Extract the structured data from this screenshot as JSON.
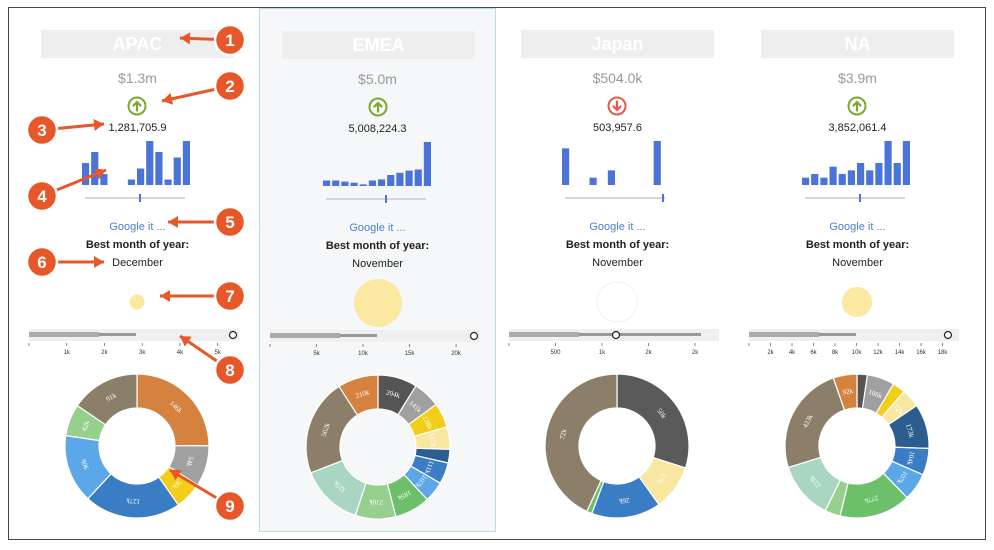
{
  "regions": [
    {
      "name": "APAC",
      "total": "$1.3m",
      "exact": "1,281,705.9",
      "trend": "up",
      "monthly": [
        4,
        6,
        2,
        0,
        0,
        1,
        3,
        8,
        6,
        1,
        5,
        8
      ],
      "slider_value": 0.55,
      "google_label": "Google it ...",
      "best_label": "Best month of year:",
      "best_value": "December",
      "bubble_scale": 0.18,
      "ticks": [
        "1k",
        "2k",
        "3k",
        "4k",
        "5k"
      ],
      "marker_value": 5.7,
      "donut": [
        {
          "label": "146k",
          "value": 146,
          "color": "#d4823e"
        },
        {
          "label": "54k",
          "value": 54,
          "color": "#a0a0a0"
        },
        {
          "label": "36k",
          "value": 36,
          "color": "#f2cd1a"
        },
        {
          "label": "127k",
          "value": 127,
          "color": "#3b7dc4"
        },
        {
          "label": "90k",
          "value": 90,
          "color": "#5ba7e8"
        },
        {
          "label": "42k",
          "value": 42,
          "color": "#96cf8e"
        },
        {
          "label": "91k",
          "value": 91,
          "color": "#8b7f6a"
        }
      ]
    },
    {
      "name": "EMEA",
      "total": "$5.0m",
      "exact": "5,008,224.3",
      "trend": "up",
      "monthly": [
        1,
        1,
        0.8,
        0.6,
        0.3,
        1,
        1.2,
        2,
        2.4,
        2.8,
        3,
        8
      ],
      "slider_value": 0.6,
      "google_label": "Google it ...",
      "best_label": "Best month of year:",
      "best_value": "November",
      "bubble_scale": 1.0,
      "ticks": [
        "5k",
        "10k",
        "15k",
        "20k"
      ],
      "marker_value": 22.5,
      "donut": [
        {
          "label": "204k",
          "value": 204,
          "color": "#555555"
        },
        {
          "label": "141k",
          "value": 141,
          "color": "#a0a0a0"
        },
        {
          "label": "128k",
          "value": 128,
          "color": "#f2cd1a"
        },
        {
          "label": "117k",
          "value": 117,
          "color": "#f7e7a1"
        },
        {
          "label": "",
          "value": 70,
          "color": "#2c5d8f"
        },
        {
          "label": "111k",
          "value": 111,
          "color": "#3b7dc4"
        },
        {
          "label": "107k",
          "value": 107,
          "color": "#5ba7e8"
        },
        {
          "label": "185k",
          "value": 185,
          "color": "#6cc06a"
        },
        {
          "label": "210k",
          "value": 210,
          "color": "#96cf8e"
        },
        {
          "label": "325k",
          "value": 325,
          "color": "#a9d6c1"
        },
        {
          "label": "502k",
          "value": 502,
          "color": "#8b7f6a"
        },
        {
          "label": "210k",
          "value": 210,
          "color": "#d4823e"
        }
      ]
    },
    {
      "name": "Japan",
      "total": "$504.0k",
      "exact": "503,957.6",
      "trend": "down",
      "monthly": [
        5,
        0,
        0,
        1,
        0,
        2,
        0,
        0,
        0,
        0,
        6,
        0
      ],
      "slider_value": 0.98,
      "google_label": "Google it ...",
      "best_label": "Best month of year:",
      "best_value": "November",
      "bubble_scale": 0.0,
      "ticks": [
        "500",
        "1k",
        "2k",
        "2k"
      ],
      "marker_value": 2.3,
      "donut": [
        {
          "label": "50k",
          "value": 50,
          "color": "#5a5a5a"
        },
        {
          "label": "17k",
          "value": 17,
          "color": "#f7e7a1"
        },
        {
          "label": "26k",
          "value": 26,
          "color": "#3b7dc4"
        },
        {
          "label": "",
          "value": 2,
          "color": "#6cc06a"
        },
        {
          "label": "72k",
          "value": 72,
          "color": "#8b7f6a"
        }
      ]
    },
    {
      "name": "NA",
      "total": "$3.9m",
      "exact": "3,852,061.4",
      "trend": "up",
      "monthly": [
        1,
        1.5,
        1,
        2.5,
        1.5,
        2,
        3,
        2,
        3,
        6,
        3,
        6
      ],
      "slider_value": 0.55,
      "google_label": "Google it ...",
      "best_label": "Best month of year:",
      "best_value": "November",
      "bubble_scale": 0.55,
      "ticks": [
        "2k",
        "4k",
        "6k",
        "8k",
        "10k",
        "12k",
        "14k",
        "16k",
        "18k"
      ],
      "marker_value": 18.5,
      "donut": [
        {
          "label": "",
          "value": 40,
          "color": "#555555"
        },
        {
          "label": "106k",
          "value": 106,
          "color": "#a0a0a0"
        },
        {
          "label": "",
          "value": 50,
          "color": "#f2cd1a"
        },
        {
          "label": "72k",
          "value": 72,
          "color": "#f7e7a1"
        },
        {
          "label": "173k",
          "value": 173,
          "color": "#2c5d8f"
        },
        {
          "label": "104k",
          "value": 104,
          "color": "#3b7dc4"
        },
        {
          "label": "107k",
          "value": 107,
          "color": "#5ba7e8"
        },
        {
          "label": "277k",
          "value": 277,
          "color": "#6cc06a"
        },
        {
          "label": "",
          "value": 60,
          "color": "#96cf8e"
        },
        {
          "label": "223k",
          "value": 223,
          "color": "#a9d6c1"
        },
        {
          "label": "423k",
          "value": 423,
          "color": "#8b7f6a"
        },
        {
          "label": "92k",
          "value": 92,
          "color": "#d4823e"
        }
      ]
    }
  ],
  "callouts": [
    "1",
    "2",
    "3",
    "4",
    "5",
    "6",
    "7",
    "8",
    "9"
  ],
  "colors": {
    "bar": "#4a74d8",
    "up": "#7ba828",
    "down": "#e45a4a",
    "callout": "#e8572a",
    "bubble": "#fbe8a1",
    "link": "#4a7fd4"
  }
}
